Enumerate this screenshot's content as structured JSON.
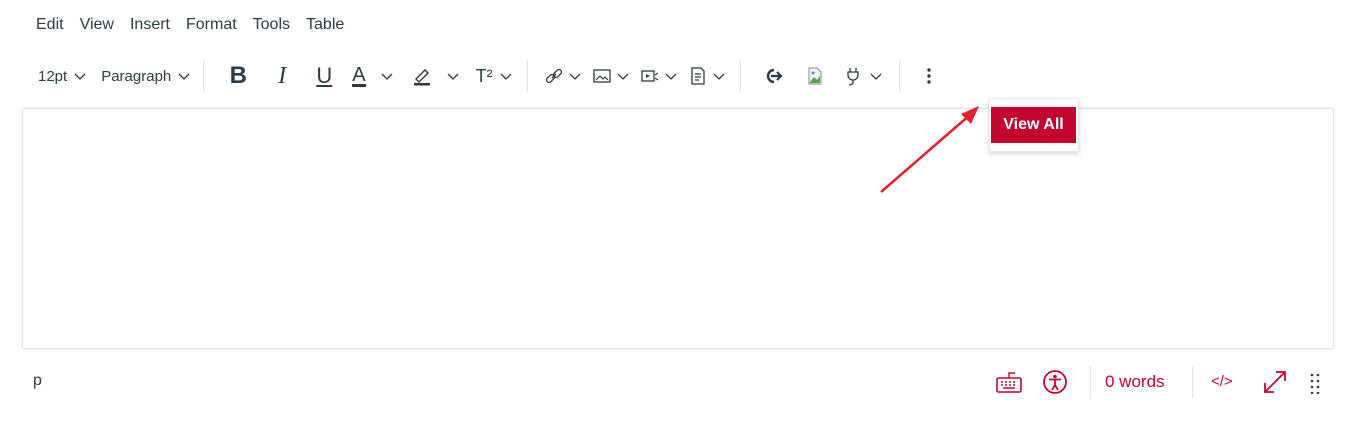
{
  "menu": [
    "Edit",
    "View",
    "Insert",
    "Format",
    "Tools",
    "Table"
  ],
  "toolbar": {
    "font_size": "12pt",
    "block_format": "Paragraph",
    "bold": "B",
    "italic": "I",
    "underline": "U",
    "text_color": "A",
    "superscript": "T²"
  },
  "tooltip": {
    "label": "View All"
  },
  "statusbar": {
    "path": "p",
    "word_count": "0 words",
    "html_toggle": "</>"
  },
  "colors": {
    "accent": "#c1052f",
    "text": "#2d3b45",
    "arrow": "#e0222e"
  },
  "icons": [
    "chevron-down-icon",
    "link-icon",
    "image-icon",
    "media-icon",
    "document-icon",
    "lti-apps-icon",
    "broken-image-icon",
    "plug-icon",
    "more-vertical-icon",
    "keyboard-icon",
    "accessibility-icon",
    "fullscreen-icon",
    "drag-handle-icon"
  ]
}
